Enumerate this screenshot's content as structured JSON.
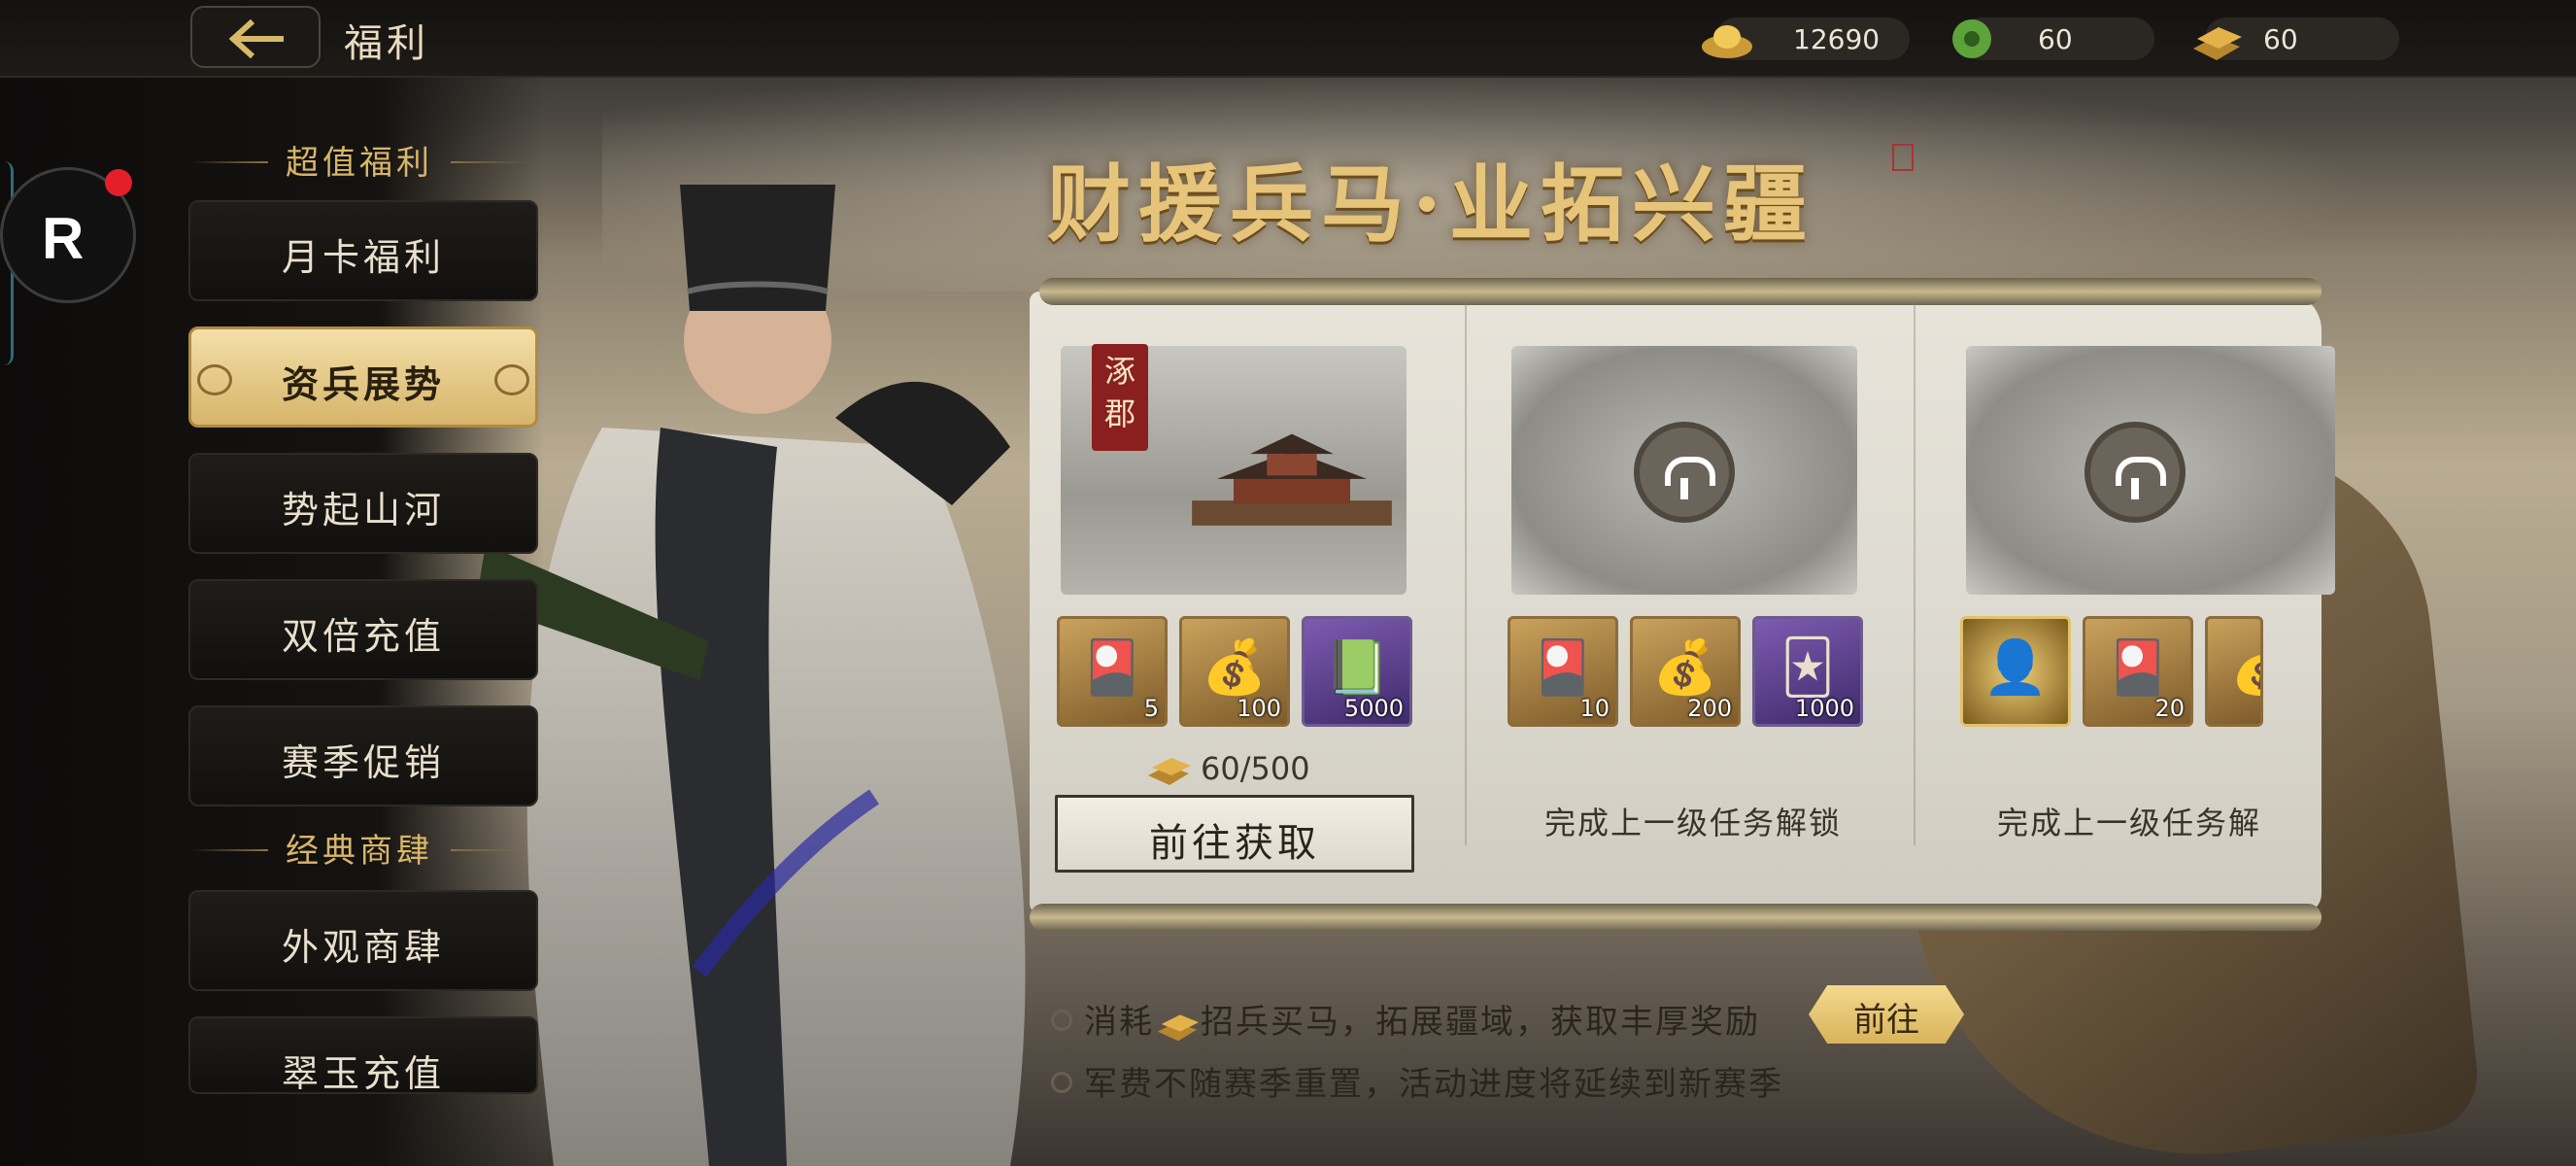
{
  "header": {
    "back_icon": "back-arrow-icon",
    "title": "福利",
    "currencies": [
      {
        "name": "gold-ingot-icon",
        "value": "12690"
      },
      {
        "name": "jade-coin-icon",
        "value": "60"
      },
      {
        "name": "gold-bar-icon",
        "value": "60"
      }
    ]
  },
  "recorder": {
    "label": "R"
  },
  "sidebar": {
    "sections": [
      {
        "title": "超值福利"
      },
      {
        "title": "经典商肆"
      }
    ],
    "items": [
      {
        "label": "月卡福利",
        "active": false
      },
      {
        "label": "资兵展势",
        "active": true
      },
      {
        "label": "势起山河",
        "active": false
      },
      {
        "label": "双倍充值",
        "active": false
      },
      {
        "label": "赛季促销",
        "active": false
      },
      {
        "label": "外观商肆",
        "active": false
      },
      {
        "label": "翠玉充值",
        "active": false
      }
    ]
  },
  "main": {
    "title": "财援兵马·业拓兴疆",
    "stages": [
      {
        "location": "涿郡",
        "unlocked": true,
        "rewards": [
          {
            "icon": "token-card-icon",
            "count": "5"
          },
          {
            "icon": "gold-ingot-icon",
            "count": "100"
          },
          {
            "icon": "book-icon",
            "count": "5000"
          }
        ],
        "progress": "60/500",
        "action": "前往获取"
      },
      {
        "unlocked": false,
        "rewards": [
          {
            "icon": "token-card-icon",
            "count": "10"
          },
          {
            "icon": "gold-ingot-icon",
            "count": "200"
          },
          {
            "icon": "purple-card-icon",
            "count": "1000"
          }
        ],
        "status": "完成上一级任务解锁"
      },
      {
        "unlocked": false,
        "rewards": [
          {
            "icon": "hero-portrait-icon",
            "count": ""
          },
          {
            "icon": "token-card-icon",
            "count": "20"
          },
          {
            "icon": "gold-ingot-icon",
            "count": ""
          }
        ],
        "status": "完成上一级任务解"
      }
    ],
    "notes": [
      {
        "prefix": "消耗",
        "text": "招兵买马，拓展疆域，获取丰厚奖励"
      },
      {
        "prefix": "",
        "text": "军费不随赛季重置，活动进度将延续到新赛季"
      }
    ],
    "goto_label": "前往"
  },
  "colors": {
    "accent_gold": "#d8b668",
    "active_tab": "#e9cf8a",
    "notification_red": "#e41f2b"
  }
}
